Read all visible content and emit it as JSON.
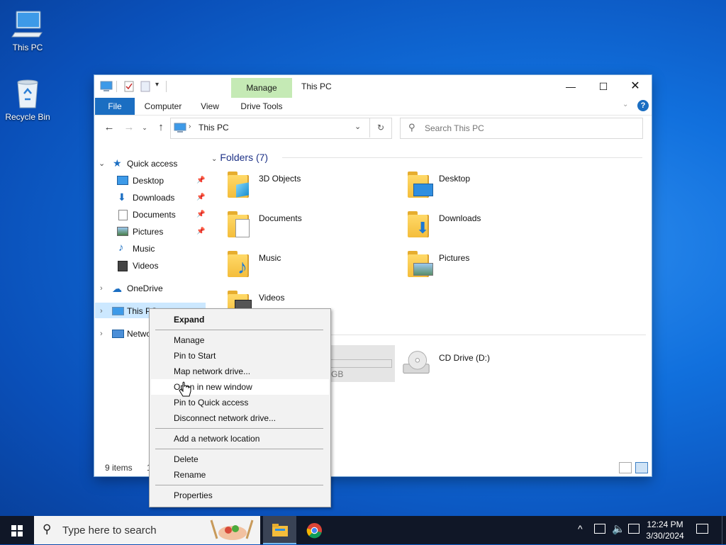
{
  "desktop": {
    "icons": [
      {
        "label": "This PC"
      },
      {
        "label": "Recycle Bin"
      }
    ]
  },
  "explorer": {
    "title": "This PC",
    "ribbon": {
      "file": "File",
      "computer": "Computer",
      "view": "View",
      "manage": "Manage",
      "drive_tools": "Drive Tools"
    },
    "address": {
      "crumb": "This PC"
    },
    "search": {
      "placeholder": "Search This PC"
    },
    "nav": {
      "quick_access": "Quick access",
      "items": [
        {
          "label": "Desktop",
          "pinned": true
        },
        {
          "label": "Downloads",
          "pinned": true
        },
        {
          "label": "Documents",
          "pinned": true
        },
        {
          "label": "Pictures",
          "pinned": true
        },
        {
          "label": "Music",
          "pinned": false
        },
        {
          "label": "Videos",
          "pinned": false
        }
      ],
      "onedrive": "OneDrive",
      "this_pc": "This PC",
      "network": "Netwo"
    },
    "content": {
      "folders_header": "Folders (7)",
      "folders": [
        "3D Objects",
        "Desktop",
        "Documents",
        "Downloads",
        "Music",
        "Pictures",
        "Videos"
      ],
      "partial_drive_text": "GB",
      "cd_drive": "CD Drive (D:)"
    },
    "status": {
      "count": "9 items",
      "partial": "1"
    }
  },
  "context_menu": {
    "items": [
      {
        "label": "Expand",
        "bold": true
      },
      {
        "label": "Manage"
      },
      {
        "label": "Pin to Start"
      },
      {
        "label": "Map network drive..."
      },
      {
        "label": "Open in new window",
        "hover": true
      },
      {
        "label": "Pin to Quick access"
      },
      {
        "label": "Disconnect network drive..."
      },
      {
        "label": "Add a network location"
      },
      {
        "label": "Delete"
      },
      {
        "label": "Rename"
      },
      {
        "label": "Properties"
      }
    ]
  },
  "taskbar": {
    "search_placeholder": "Type here to search",
    "time": "12:24 PM",
    "date": "3/30/2024"
  },
  "colors": {
    "accent": "#1b6ec2",
    "manage_tab": "#c5eab5",
    "selection": "#cce8ff",
    "taskbar": "#101727"
  }
}
